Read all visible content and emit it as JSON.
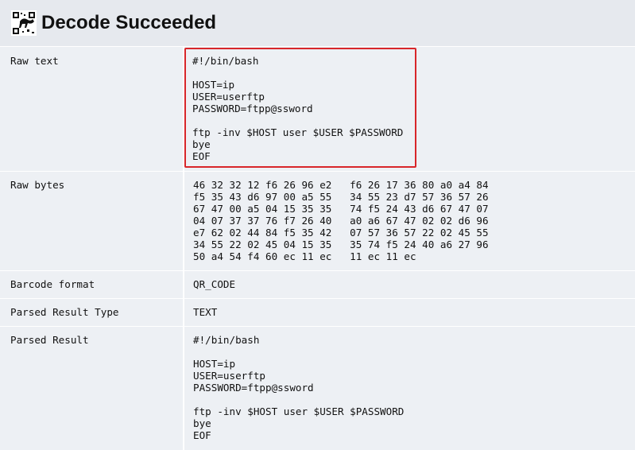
{
  "header": {
    "title": "Decode Succeeded",
    "logo_icon": "zxing-qr-logo-icon"
  },
  "rows": [
    {
      "key": "Raw text",
      "value": "#!/bin/bash\n\nHOST=ip\nUSER=userftp\nPASSWORD=ftpp@ssword\n\nftp -inv $HOST user $USER $PASSWORD\nbye\nEOF"
    },
    {
      "key": "Raw bytes",
      "value": "46 32 32 12 f6 26 96 e2   f6 26 17 36 80 a0 a4 84\nf5 35 43 d6 97 00 a5 55   34 55 23 d7 57 36 57 26\n67 47 00 a5 04 15 35 35   74 f5 24 43 d6 67 47 07\n04 07 37 37 76 f7 26 40   a0 a6 67 47 02 02 d6 96\ne7 62 02 44 84 f5 35 42   07 57 36 57 22 02 45 55\n34 55 22 02 45 04 15 35   35 74 f5 24 40 a6 27 96\n50 a4 54 f4 60 ec 11 ec   11 ec 11 ec"
    },
    {
      "key": "Barcode format",
      "value": "QR_CODE"
    },
    {
      "key": "Parsed Result Type",
      "value": "TEXT"
    },
    {
      "key": "Parsed Result",
      "value": "#!/bin/bash\n\nHOST=ip\nUSER=userftp\nPASSWORD=ftpp@ssword\n\nftp -inv $HOST user $USER $PASSWORD\nbye\nEOF"
    }
  ],
  "colors": {
    "highlight_border": "#d8262a",
    "row_background": "#edf0f4",
    "page_background": "#e6e9ee"
  }
}
